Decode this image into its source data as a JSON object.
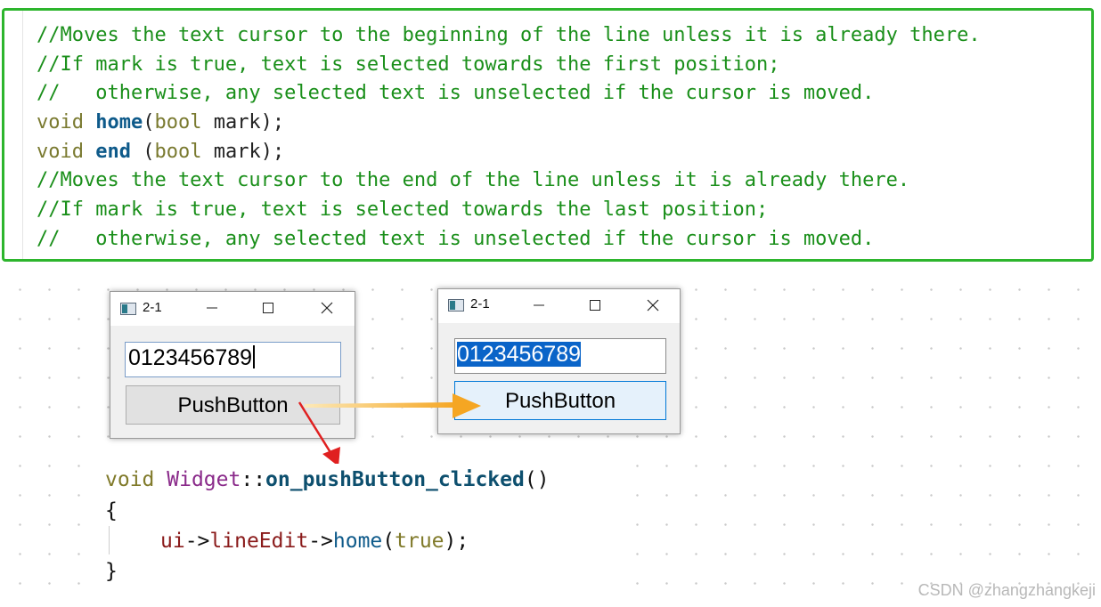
{
  "doc_comment": {
    "lines": [
      {
        "text": "//Moves the text cursor to the beginning of the line unless it is already there."
      },
      {
        "text": "//If mark is true, text is selected towards the first position;"
      },
      {
        "text": "//   otherwise, any selected text is unselected if the cursor is moved."
      },
      {
        "type": "void",
        "name": "home",
        "pre": "(",
        "param_type": "bool",
        "param": " mark);"
      },
      {
        "type": "void",
        "name": "end",
        "pre": " (",
        "param_type": "bool",
        "param": " mark);"
      },
      {
        "text": "//Moves the text cursor to the end of the line unless it is already there."
      },
      {
        "text": "//If mark is true, text is selected towards the last position;"
      },
      {
        "text": "//   otherwise, any selected text is unselected if the cursor is moved."
      }
    ]
  },
  "window_before": {
    "title": "2-1",
    "line_edit_value": "0123456789",
    "button_label": "PushButton"
  },
  "window_after": {
    "title": "2-1",
    "line_edit_value": "0123456789",
    "button_label": "PushButton"
  },
  "slot_code": {
    "line1": {
      "kw": "void",
      "cls": "Widget",
      "sep": "::",
      "fn": "on_pushButton_clicked",
      "tail": "()"
    },
    "line2": "{",
    "line3": {
      "obj": "ui",
      "arrow1": "->",
      "mem": "lineEdit",
      "arrow2": "->",
      "call": "home",
      "open": "(",
      "arg": "true",
      "close": ");"
    },
    "line4": "}"
  },
  "watermark": "CSDN @zhangzhangkeji",
  "colors": {
    "border_green": "#2db52d",
    "comment_green": "#1a8f1a",
    "selection_blue": "#0a64c8",
    "arrow_orange": "#f5a623",
    "arrow_red": "#e02020"
  }
}
